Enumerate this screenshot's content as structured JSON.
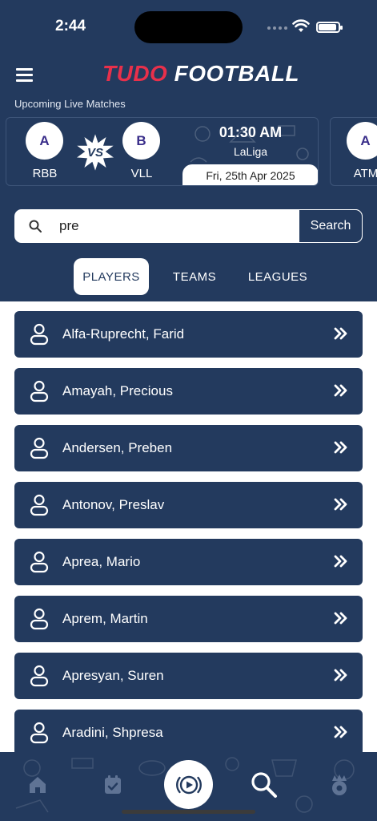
{
  "status_bar": {
    "time": "2:44"
  },
  "header": {
    "logo_part1": "TUDO",
    "logo_part2": "FOOTBALL",
    "section_label": "Upcoming Live Matches"
  },
  "matches": [
    {
      "home_badge": "A",
      "home_name": "RBB",
      "away_badge": "B",
      "away_name": "VLL",
      "vs_label": "VS",
      "time": "01:30 AM",
      "league": "LaLiga",
      "date": "Fri, 25th Apr 2025"
    },
    {
      "home_badge": "A",
      "home_name": "ATM"
    }
  ],
  "search": {
    "value": "pre",
    "button_label": "Search"
  },
  "tabs": [
    {
      "label": "PLAYERS",
      "active": true
    },
    {
      "label": "TEAMS",
      "active": false
    },
    {
      "label": "LEAGUES",
      "active": false
    }
  ],
  "players": [
    {
      "name": "Alfa-Ruprecht, Farid"
    },
    {
      "name": "Amayah, Precious"
    },
    {
      "name": "Andersen, Preben"
    },
    {
      "name": "Antonov, Preslav"
    },
    {
      "name": "Aprea, Mario"
    },
    {
      "name": "Aprem, Martin"
    },
    {
      "name": "Apresyan, Suren"
    },
    {
      "name": "Aradini, Shpresa"
    }
  ],
  "bottom_nav": [
    {
      "icon": "home-icon"
    },
    {
      "icon": "calendar-check-icon"
    },
    {
      "icon": "live-play-icon"
    },
    {
      "icon": "search-icon"
    },
    {
      "icon": "club-crest-icon"
    }
  ],
  "colors": {
    "primary": "#233a5e",
    "accent": "#e8304b",
    "white": "#ffffff",
    "badge_text": "#3a2e8a"
  }
}
